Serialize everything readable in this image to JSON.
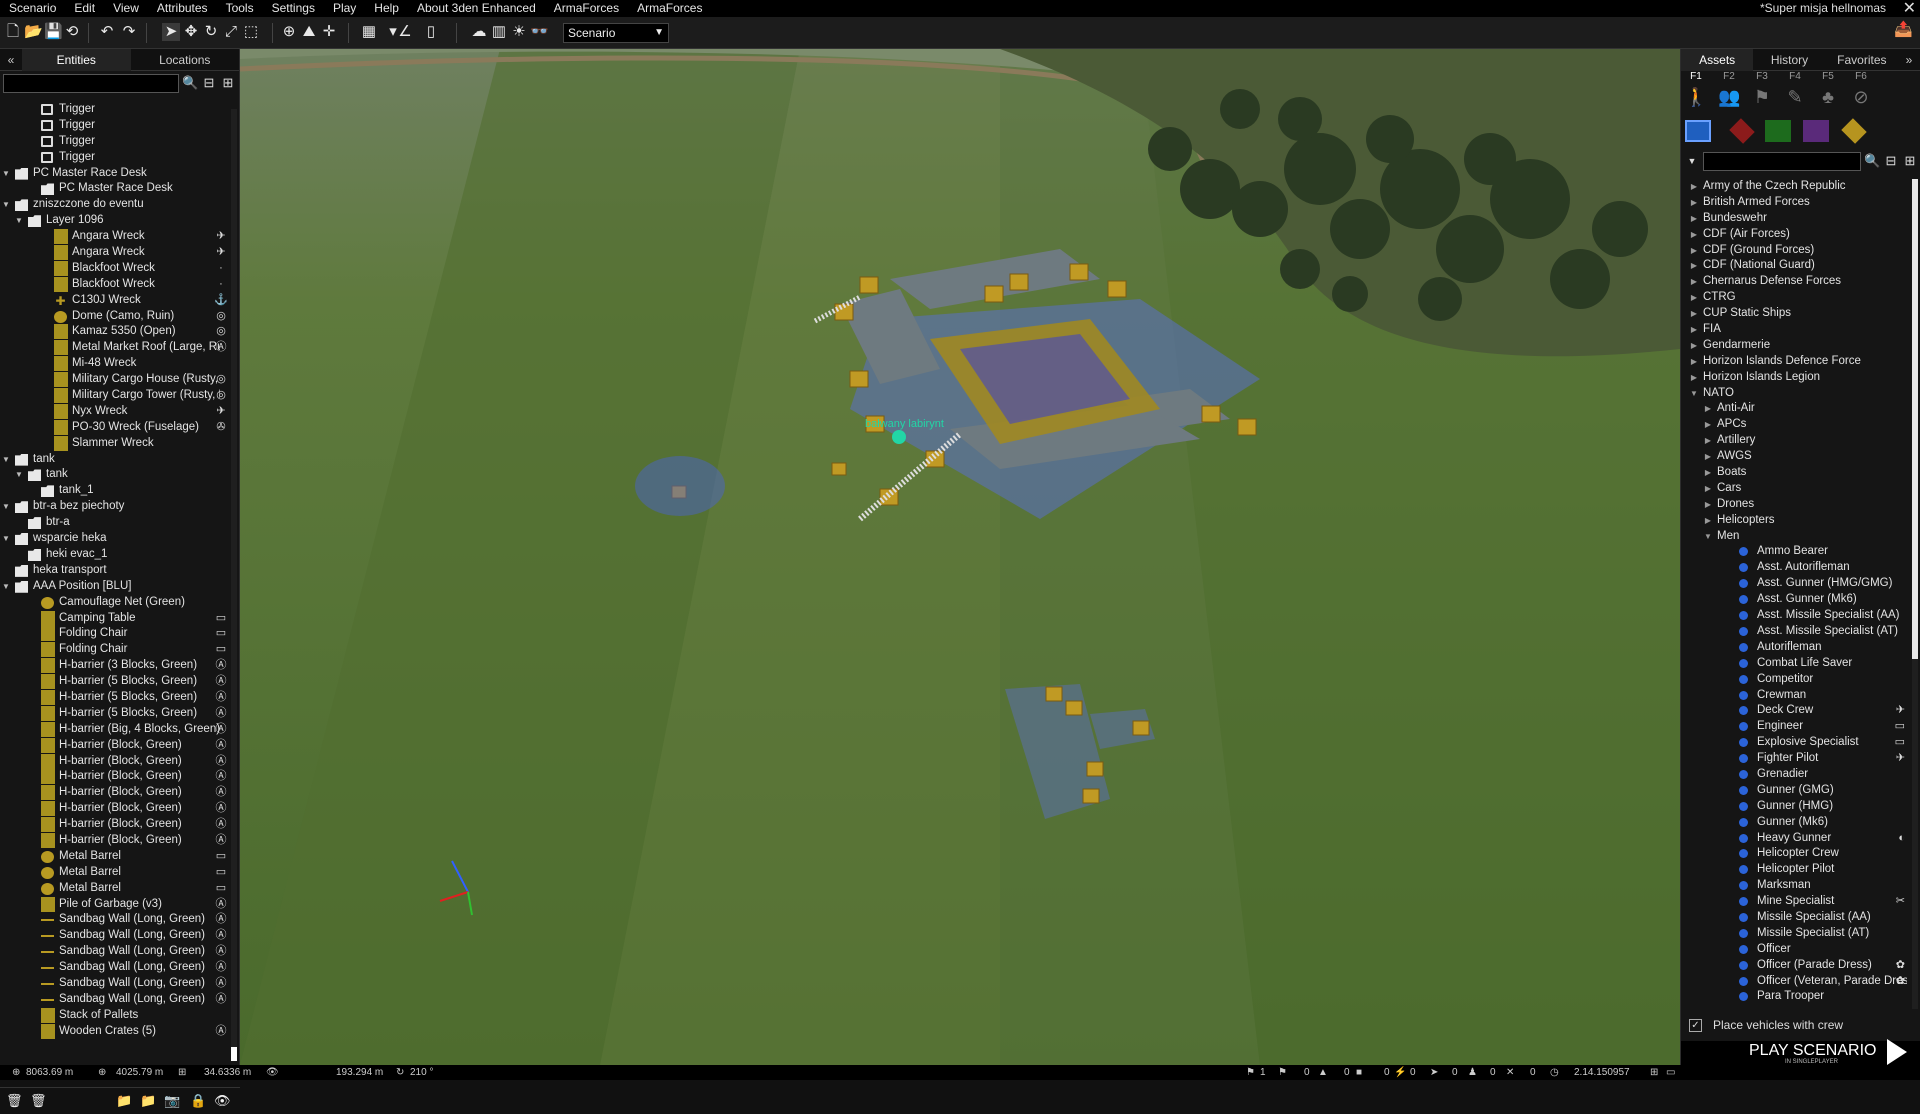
{
  "menu": [
    "Scenario",
    "Edit",
    "View",
    "Attributes",
    "Tools",
    "Settings",
    "Play",
    "Help",
    "About 3den Enhanced",
    "ArmaForces",
    "ArmaForces"
  ],
  "mission_title": "*Super misja hellnomas",
  "toolbar": {
    "scenario_value": "Scenario"
  },
  "left_panel": {
    "tabs": [
      "Entities",
      "Locations"
    ],
    "active_tab": "Entities",
    "entities": [
      {
        "d": 3,
        "icon": "trigger",
        "label": "Trigger"
      },
      {
        "d": 3,
        "icon": "trigger",
        "label": "Trigger"
      },
      {
        "d": 3,
        "icon": "trigger",
        "label": "Trigger"
      },
      {
        "d": 3,
        "icon": "trigger",
        "label": "Trigger"
      },
      {
        "d": 1,
        "t": "▼",
        "icon": "folder",
        "label": "PC Master Race Desk"
      },
      {
        "d": 3,
        "icon": "folder",
        "label": "PC Master Race Desk"
      },
      {
        "d": 1,
        "t": "▼",
        "icon": "folder",
        "label": "zniszczone do eventu"
      },
      {
        "d": 2,
        "t": "▼",
        "icon": "folder",
        "label": "Layer 1096"
      },
      {
        "d": 4,
        "icon": "obj",
        "label": "Angara Wreck",
        "r": "✈"
      },
      {
        "d": 4,
        "icon": "obj",
        "label": "Angara Wreck",
        "r": "✈"
      },
      {
        "d": 4,
        "icon": "obj",
        "label": "Blackfoot Wreck",
        "r": "·"
      },
      {
        "d": 4,
        "icon": "obj",
        "label": "Blackfoot Wreck",
        "r": "·"
      },
      {
        "d": 4,
        "icon": "plane",
        "label": "C130J Wreck",
        "r": "⚓"
      },
      {
        "d": 4,
        "icon": "round",
        "label": "Dome (Camo, Ruin)",
        "r": "◎"
      },
      {
        "d": 4,
        "icon": "obj",
        "label": "Kamaz 5350 (Open)",
        "r": "◎"
      },
      {
        "d": 4,
        "icon": "obj",
        "label": "Metal Market Roof (Large, Ruin)",
        "r": "Ⓐ"
      },
      {
        "d": 4,
        "icon": "obj",
        "label": "Mi-48 Wreck",
        "r": ""
      },
      {
        "d": 4,
        "icon": "obj",
        "label": "Military Cargo House (Rusty, Ruin)",
        "r": "◎"
      },
      {
        "d": 4,
        "icon": "obj",
        "label": "Military Cargo Tower (Rusty, Ruin)",
        "r": "◎"
      },
      {
        "d": 4,
        "icon": "obj",
        "label": "Nyx Wreck",
        "r": "✈"
      },
      {
        "d": 4,
        "icon": "obj",
        "label": "PO-30 Wreck (Fuselage)",
        "r": "✇"
      },
      {
        "d": 4,
        "icon": "obj",
        "label": "Slammer Wreck",
        "r": ""
      },
      {
        "d": 1,
        "t": "▼",
        "icon": "folder",
        "label": "tank"
      },
      {
        "d": 2,
        "t": "▼",
        "icon": "folder",
        "label": "tank"
      },
      {
        "d": 3,
        "icon": "folder",
        "label": "tank_1"
      },
      {
        "d": 1,
        "t": "▼",
        "icon": "folder",
        "label": "btr-a bez piechoty"
      },
      {
        "d": 2,
        "icon": "folder",
        "label": "btr-a"
      },
      {
        "d": 1,
        "t": "▼",
        "icon": "folder",
        "label": "wsparcie heka"
      },
      {
        "d": 2,
        "icon": "folder",
        "label": "heki evac_1"
      },
      {
        "d": 1,
        "icon": "folder",
        "label": "heka transport"
      },
      {
        "d": 1,
        "t": "▼",
        "icon": "folder",
        "label": "AAA Position [BLU]"
      },
      {
        "d": 3,
        "icon": "round",
        "label": "Camouflage Net (Green)",
        "r": ""
      },
      {
        "d": 3,
        "icon": "obj",
        "label": "Camping Table",
        "r": "▭"
      },
      {
        "d": 3,
        "icon": "obj",
        "label": "Folding Chair",
        "r": "▭"
      },
      {
        "d": 3,
        "icon": "obj",
        "label": "Folding Chair",
        "r": "▭"
      },
      {
        "d": 3,
        "icon": "obj",
        "label": "H-barrier (3 Blocks, Green)",
        "r": "Ⓐ"
      },
      {
        "d": 3,
        "icon": "obj",
        "label": "H-barrier (5 Blocks, Green)",
        "r": "Ⓐ"
      },
      {
        "d": 3,
        "icon": "obj",
        "label": "H-barrier (5 Blocks, Green)",
        "r": "Ⓐ"
      },
      {
        "d": 3,
        "icon": "obj",
        "label": "H-barrier (5 Blocks, Green)",
        "r": "Ⓐ"
      },
      {
        "d": 3,
        "icon": "obj",
        "label": "H-barrier (Big, 4 Blocks, Green)",
        "r": "Ⓐ"
      },
      {
        "d": 3,
        "icon": "obj",
        "label": "H-barrier (Block, Green)",
        "r": "Ⓐ"
      },
      {
        "d": 3,
        "icon": "obj",
        "label": "H-barrier (Block, Green)",
        "r": "Ⓐ"
      },
      {
        "d": 3,
        "icon": "obj",
        "label": "H-barrier (Block, Green)",
        "r": "Ⓐ"
      },
      {
        "d": 3,
        "icon": "obj",
        "label": "H-barrier (Block, Green)",
        "r": "Ⓐ"
      },
      {
        "d": 3,
        "icon": "obj",
        "label": "H-barrier (Block, Green)",
        "r": "Ⓐ"
      },
      {
        "d": 3,
        "icon": "obj",
        "label": "H-barrier (Block, Green)",
        "r": "Ⓐ"
      },
      {
        "d": 3,
        "icon": "obj",
        "label": "H-barrier (Block, Green)",
        "r": "Ⓐ"
      },
      {
        "d": 3,
        "icon": "round",
        "label": "Metal Barrel",
        "r": "▭"
      },
      {
        "d": 3,
        "icon": "round",
        "label": "Metal Barrel",
        "r": "▭"
      },
      {
        "d": 3,
        "icon": "round",
        "label": "Metal Barrel",
        "r": "▭"
      },
      {
        "d": 3,
        "icon": "obj",
        "label": "Pile of Garbage (v3)",
        "r": "Ⓐ"
      },
      {
        "d": 3,
        "icon": "line",
        "label": "Sandbag Wall (Long, Green)",
        "r": "Ⓐ"
      },
      {
        "d": 3,
        "icon": "line",
        "label": "Sandbag Wall (Long, Green)",
        "r": "Ⓐ"
      },
      {
        "d": 3,
        "icon": "line",
        "label": "Sandbag Wall (Long, Green)",
        "r": "Ⓐ"
      },
      {
        "d": 3,
        "icon": "line",
        "label": "Sandbag Wall (Long, Green)",
        "r": "Ⓐ"
      },
      {
        "d": 3,
        "icon": "line",
        "label": "Sandbag Wall (Long, Green)",
        "r": "Ⓐ"
      },
      {
        "d": 3,
        "icon": "line",
        "label": "Sandbag Wall (Long, Green)",
        "r": "Ⓐ"
      },
      {
        "d": 3,
        "icon": "obj",
        "label": "Stack of Pallets",
        "r": ""
      },
      {
        "d": 3,
        "icon": "obj",
        "label": "Wooden Crates (5)",
        "r": "Ⓐ"
      }
    ]
  },
  "right_panel": {
    "tabs": [
      "Assets",
      "History",
      "Favorites"
    ],
    "active_tab": "Assets",
    "fkeys": [
      "F1",
      "F2",
      "F3",
      "F4",
      "F5",
      "F6"
    ],
    "fkey_icons": [
      "person-icon",
      "group-icon",
      "module-icon",
      "waypoint-icon",
      "marker-icon",
      "erase-icon"
    ],
    "faction_colors": [
      "#1f5fbf",
      "#8c1b1b",
      "#1d6b1d",
      "#5a2a7a",
      "#b6941f"
    ],
    "assets": [
      {
        "d": 0,
        "t": "▶",
        "label": "Army of the Czech Republic"
      },
      {
        "d": 0,
        "t": "▶",
        "label": "British Armed Forces"
      },
      {
        "d": 0,
        "t": "▶",
        "label": "Bundeswehr"
      },
      {
        "d": 0,
        "t": "▶",
        "label": "CDF (Air Forces)"
      },
      {
        "d": 0,
        "t": "▶",
        "label": "CDF (Ground Forces)"
      },
      {
        "d": 0,
        "t": "▶",
        "label": "CDF (National Guard)"
      },
      {
        "d": 0,
        "t": "▶",
        "label": "Chernarus Defense Forces"
      },
      {
        "d": 0,
        "t": "▶",
        "label": "CTRG"
      },
      {
        "d": 0,
        "t": "▶",
        "label": "CUP Static Ships"
      },
      {
        "d": 0,
        "t": "▶",
        "label": "FIA"
      },
      {
        "d": 0,
        "t": "▶",
        "label": "Gendarmerie"
      },
      {
        "d": 0,
        "t": "▶",
        "label": "Horizon Islands Defence Force"
      },
      {
        "d": 0,
        "t": "▶",
        "label": "Horizon Islands Legion"
      },
      {
        "d": 0,
        "t": "▼",
        "label": "NATO"
      },
      {
        "d": 1,
        "t": "▶",
        "label": "Anti-Air"
      },
      {
        "d": 1,
        "t": "▶",
        "label": "APCs"
      },
      {
        "d": 1,
        "t": "▶",
        "label": "Artillery"
      },
      {
        "d": 1,
        "t": "▶",
        "label": "AWGS"
      },
      {
        "d": 1,
        "t": "▶",
        "label": "Boats"
      },
      {
        "d": 1,
        "t": "▶",
        "label": "Cars"
      },
      {
        "d": 1,
        "t": "▶",
        "label": "Drones"
      },
      {
        "d": 1,
        "t": "▶",
        "label": "Helicopters"
      },
      {
        "d": 1,
        "t": "▼",
        "label": "Men"
      },
      {
        "d": 2,
        "u": true,
        "label": "Ammo Bearer"
      },
      {
        "d": 2,
        "u": true,
        "label": "Asst. Autorifleman"
      },
      {
        "d": 2,
        "u": true,
        "label": "Asst. Gunner (HMG/GMG)"
      },
      {
        "d": 2,
        "u": true,
        "label": "Asst. Gunner (Mk6)"
      },
      {
        "d": 2,
        "u": true,
        "label": "Asst. Missile Specialist (AA)"
      },
      {
        "d": 2,
        "u": true,
        "label": "Asst. Missile Specialist (AT)"
      },
      {
        "d": 2,
        "u": true,
        "label": "Autorifleman"
      },
      {
        "d": 2,
        "u": true,
        "label": "Combat Life Saver"
      },
      {
        "d": 2,
        "u": true,
        "label": "Competitor"
      },
      {
        "d": 2,
        "u": true,
        "label": "Crewman"
      },
      {
        "d": 2,
        "u": true,
        "label": "Deck Crew",
        "r": "✈"
      },
      {
        "d": 2,
        "u": true,
        "label": "Engineer",
        "r": "▭"
      },
      {
        "d": 2,
        "u": true,
        "label": "Explosive Specialist",
        "r": "▭"
      },
      {
        "d": 2,
        "u": true,
        "label": "Fighter Pilot",
        "r": "✈"
      },
      {
        "d": 2,
        "u": true,
        "label": "Grenadier"
      },
      {
        "d": 2,
        "u": true,
        "label": "Gunner (GMG)"
      },
      {
        "d": 2,
        "u": true,
        "label": "Gunner (HMG)"
      },
      {
        "d": 2,
        "u": true,
        "label": "Gunner (Mk6)"
      },
      {
        "d": 2,
        "u": true,
        "label": "Heavy Gunner",
        "r": "◐"
      },
      {
        "d": 2,
        "u": true,
        "label": "Helicopter Crew"
      },
      {
        "d": 2,
        "u": true,
        "label": "Helicopter Pilot"
      },
      {
        "d": 2,
        "u": true,
        "label": "Marksman"
      },
      {
        "d": 2,
        "u": true,
        "label": "Mine Specialist",
        "r": "✂"
      },
      {
        "d": 2,
        "u": true,
        "label": "Missile Specialist (AA)"
      },
      {
        "d": 2,
        "u": true,
        "label": "Missile Specialist (AT)"
      },
      {
        "d": 2,
        "u": true,
        "label": "Officer"
      },
      {
        "d": 2,
        "u": true,
        "label": "Officer (Parade Dress)",
        "r": "✿"
      },
      {
        "d": 2,
        "u": true,
        "label": "Officer (Veteran, Parade Dress)",
        "r": "✿"
      },
      {
        "d": 2,
        "u": true,
        "label": "Para Trooper"
      }
    ],
    "place_vehicles_with_crew": "Place vehicles with crew",
    "play": {
      "label": "PLAY SCENARIO",
      "sub": "IN SINGLEPLAYER"
    }
  },
  "viewport": {
    "marker_label": "bałwany labirynt"
  },
  "statusbar": {
    "pos_x": "8063.69 m",
    "pos_y": "4025.79 m",
    "pos_z": "34.6336 m",
    "cam_dist": "193.294 m",
    "cam_dir": "210 °",
    "counts": [
      "1",
      "0",
      "0",
      "0",
      "0",
      "0",
      "0",
      "0",
      "0"
    ],
    "version": "2.14.150957"
  }
}
